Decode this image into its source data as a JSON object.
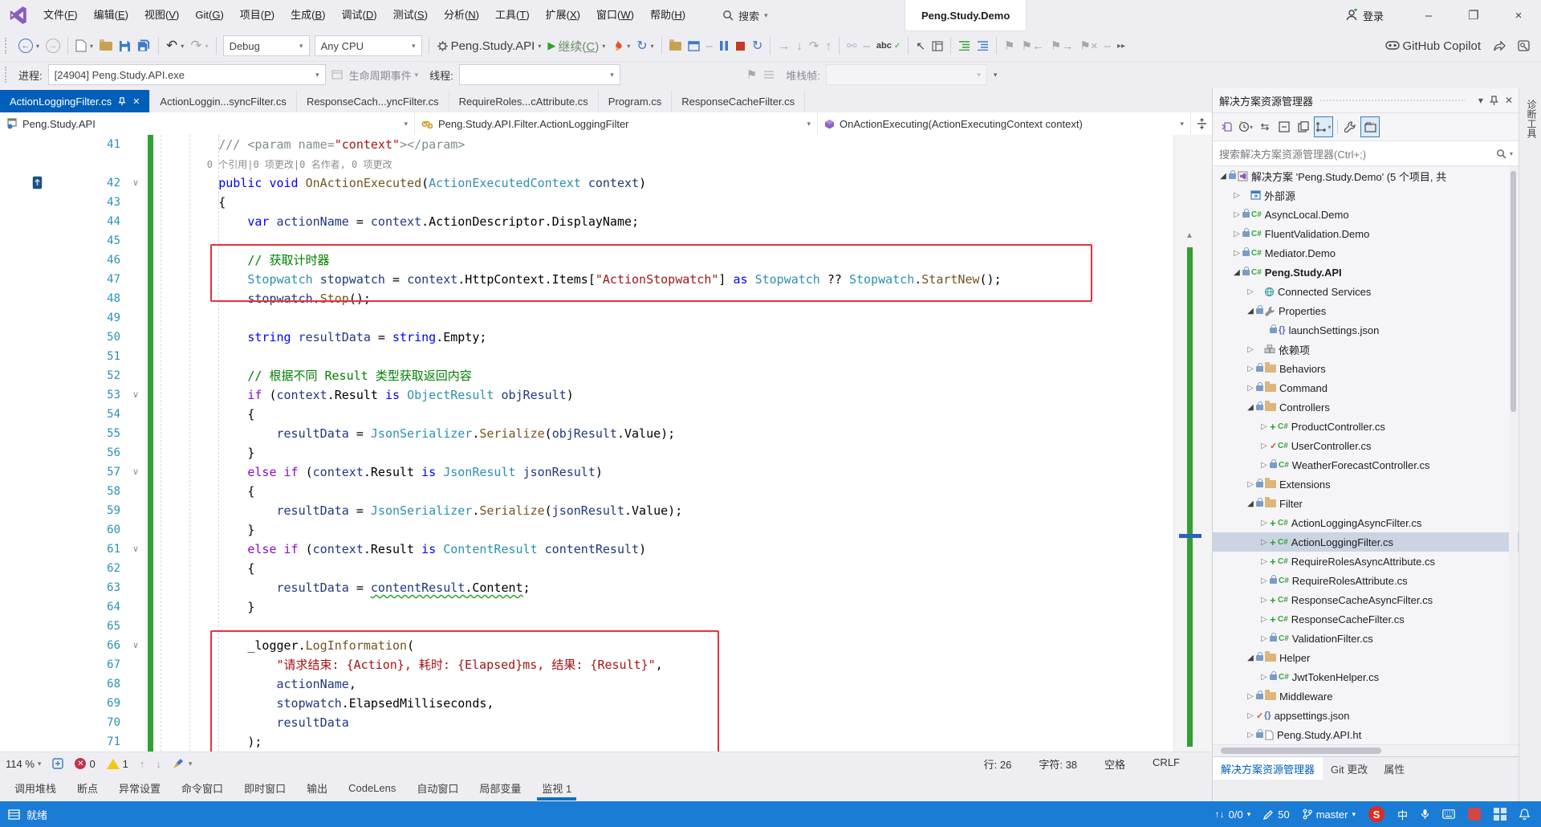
{
  "chrome": {
    "menus": [
      "文件(F)",
      "编辑(E)",
      "视图(V)",
      "Git(G)",
      "项目(P)",
      "生成(B)",
      "调试(D)",
      "测试(S)",
      "分析(N)",
      "工具(T)",
      "扩展(X)",
      "窗口(W)",
      "帮助(H)"
    ],
    "search_label": "搜索",
    "window_title": "Peng.Study.Demo",
    "signin_label": "登录"
  },
  "toolbar": {
    "debug_config": "Debug",
    "platform": "Any CPU",
    "startup_project": "Peng.Study.API",
    "continue_label": "继续(C)",
    "copilot_label": "GitHub Copilot"
  },
  "debugbar": {
    "process_label": "进程:",
    "process_value": "[24904] Peng.Study.API.exe",
    "lifecycle_label": "生命周期事件",
    "thread_label": "线程:",
    "stackframe_label": "堆栈帧:"
  },
  "tabs": [
    {
      "label": "ActionLoggingFilter.cs",
      "active": true
    },
    {
      "label": "ActionLoggin...syncFilter.cs",
      "active": false
    },
    {
      "label": "ResponseCach...yncFilter.cs",
      "active": false
    },
    {
      "label": "RequireRoles...cAttribute.cs",
      "active": false
    },
    {
      "label": "Program.cs",
      "active": false
    },
    {
      "label": "ResponseCacheFilter.cs",
      "active": false
    }
  ],
  "breadcrumb": [
    "Peng.Study.API",
    "Peng.Study.API.Filter.ActionLoggingFilter",
    "OnActionExecuting(ActionExecutingContext context)"
  ],
  "editor": {
    "rows": [
      {
        "n": "41",
        "seg": [
          [
            "dc",
            "        /// <param name="
          ],
          [
            "s",
            "\"context\""
          ],
          [
            "dc",
            "></param>"
          ]
        ]
      },
      {
        "n": "",
        "lens": true,
        "seg": [
          [
            "lens",
            "        0 个引用|0 项更改|0 名作者, 0 项更改"
          ]
        ]
      },
      {
        "n": "42",
        "fold": true,
        "icon": true,
        "seg": [
          [
            "p",
            "        "
          ],
          [
            "k",
            "public"
          ],
          [
            "p",
            " "
          ],
          [
            "k",
            "void"
          ],
          [
            "p",
            " "
          ],
          [
            "m",
            "OnActionExecuted"
          ],
          [
            "p",
            "("
          ],
          [
            "ty",
            "ActionExecutedContext"
          ],
          [
            "p",
            " "
          ],
          [
            "v",
            "context"
          ],
          [
            "p",
            ")"
          ]
        ]
      },
      {
        "n": "43",
        "seg": [
          [
            "p",
            "        {"
          ]
        ]
      },
      {
        "n": "44",
        "seg": [
          [
            "p",
            "            "
          ],
          [
            "k",
            "var"
          ],
          [
            "p",
            " "
          ],
          [
            "v",
            "actionName"
          ],
          [
            "p",
            " = "
          ],
          [
            "v",
            "context"
          ],
          [
            "p",
            ".ActionDescriptor.DisplayName;"
          ]
        ]
      },
      {
        "n": "45",
        "seg": []
      },
      {
        "n": "46",
        "seg": [
          [
            "c",
            "            // 获取计时器"
          ]
        ]
      },
      {
        "n": "47",
        "seg": [
          [
            "p",
            "            "
          ],
          [
            "ty",
            "Stopwatch"
          ],
          [
            "p",
            " "
          ],
          [
            "v",
            "stopwatch"
          ],
          [
            "p",
            " = "
          ],
          [
            "v",
            "context"
          ],
          [
            "p",
            ".HttpContext.Items["
          ],
          [
            "s",
            "\"ActionStopwatch\""
          ],
          [
            "p",
            "] "
          ],
          [
            "k",
            "as"
          ],
          [
            "p",
            " "
          ],
          [
            "ty",
            "Stopwatch"
          ],
          [
            "p",
            " ?? "
          ],
          [
            "ty",
            "Stopwatch"
          ],
          [
            "p",
            "."
          ],
          [
            "m",
            "StartNew"
          ],
          [
            "p",
            "();"
          ]
        ]
      },
      {
        "n": "48",
        "seg": [
          [
            "p",
            "            "
          ],
          [
            "v",
            "stopwatch"
          ],
          [
            "p",
            "."
          ],
          [
            "m",
            "Stop"
          ],
          [
            "p",
            "();"
          ]
        ]
      },
      {
        "n": "49",
        "seg": []
      },
      {
        "n": "50",
        "seg": [
          [
            "p",
            "            "
          ],
          [
            "k",
            "string"
          ],
          [
            "p",
            " "
          ],
          [
            "v",
            "resultData"
          ],
          [
            "p",
            " = "
          ],
          [
            "k",
            "string"
          ],
          [
            "p",
            ".Empty;"
          ]
        ]
      },
      {
        "n": "51",
        "seg": []
      },
      {
        "n": "52",
        "seg": [
          [
            "c",
            "            // 根据不同 Result 类型获取返回内容"
          ]
        ]
      },
      {
        "n": "53",
        "fold": true,
        "seg": [
          [
            "p",
            "            "
          ],
          [
            "ct",
            "if"
          ],
          [
            "p",
            " ("
          ],
          [
            "v",
            "context"
          ],
          [
            "p",
            ".Result "
          ],
          [
            "k",
            "is"
          ],
          [
            "p",
            " "
          ],
          [
            "ty",
            "ObjectResult"
          ],
          [
            "p",
            " "
          ],
          [
            "v",
            "objResult"
          ],
          [
            "p",
            ")"
          ]
        ]
      },
      {
        "n": "54",
        "seg": [
          [
            "p",
            "            {"
          ]
        ]
      },
      {
        "n": "55",
        "seg": [
          [
            "p",
            "                "
          ],
          [
            "v",
            "resultData"
          ],
          [
            "p",
            " = "
          ],
          [
            "ty",
            "JsonSerializer"
          ],
          [
            "p",
            "."
          ],
          [
            "m",
            "Serialize"
          ],
          [
            "p",
            "("
          ],
          [
            "v",
            "objResult"
          ],
          [
            "p",
            ".Value);"
          ]
        ]
      },
      {
        "n": "56",
        "seg": [
          [
            "p",
            "            }"
          ]
        ]
      },
      {
        "n": "57",
        "fold": true,
        "seg": [
          [
            "p",
            "            "
          ],
          [
            "ct",
            "else"
          ],
          [
            "p",
            " "
          ],
          [
            "ct",
            "if"
          ],
          [
            "p",
            " ("
          ],
          [
            "v",
            "context"
          ],
          [
            "p",
            ".Result "
          ],
          [
            "k",
            "is"
          ],
          [
            "p",
            " "
          ],
          [
            "ty",
            "JsonResult"
          ],
          [
            "p",
            " "
          ],
          [
            "v",
            "jsonResult"
          ],
          [
            "p",
            ")"
          ]
        ]
      },
      {
        "n": "58",
        "seg": [
          [
            "p",
            "            {"
          ]
        ]
      },
      {
        "n": "59",
        "seg": [
          [
            "p",
            "                "
          ],
          [
            "v",
            "resultData"
          ],
          [
            "p",
            " = "
          ],
          [
            "ty",
            "JsonSerializer"
          ],
          [
            "p",
            "."
          ],
          [
            "m",
            "Serialize"
          ],
          [
            "p",
            "("
          ],
          [
            "v",
            "jsonResult"
          ],
          [
            "p",
            ".Value);"
          ]
        ]
      },
      {
        "n": "60",
        "seg": [
          [
            "p",
            "            }"
          ]
        ]
      },
      {
        "n": "61",
        "fold": true,
        "seg": [
          [
            "p",
            "            "
          ],
          [
            "ct",
            "else"
          ],
          [
            "p",
            " "
          ],
          [
            "ct",
            "if"
          ],
          [
            "p",
            " ("
          ],
          [
            "v",
            "context"
          ],
          [
            "p",
            ".Result "
          ],
          [
            "k",
            "is"
          ],
          [
            "p",
            " "
          ],
          [
            "ty",
            "ContentResult"
          ],
          [
            "p",
            " "
          ],
          [
            "v",
            "contentResult"
          ],
          [
            "p",
            ")"
          ]
        ]
      },
      {
        "n": "62",
        "seg": [
          [
            "p",
            "            {"
          ]
        ]
      },
      {
        "n": "63",
        "seg": [
          [
            "p",
            "                "
          ],
          [
            "v",
            "resultData"
          ],
          [
            "p",
            " = "
          ],
          [
            "v sq",
            "contentResult"
          ],
          [
            "p sq",
            ".Content"
          ],
          [
            "p",
            ";"
          ]
        ]
      },
      {
        "n": "64",
        "seg": [
          [
            "p",
            "            }"
          ]
        ]
      },
      {
        "n": "65",
        "seg": []
      },
      {
        "n": "66",
        "fold": true,
        "seg": [
          [
            "p",
            "            _logger."
          ],
          [
            "m",
            "LogInformation"
          ],
          [
            "p",
            "("
          ]
        ]
      },
      {
        "n": "67",
        "seg": [
          [
            "p",
            "                "
          ],
          [
            "s",
            "\"请求结束: {Action}, 耗时: {Elapsed}ms, 结果: {Result}\""
          ],
          [
            "p",
            ","
          ]
        ]
      },
      {
        "n": "68",
        "seg": [
          [
            "p",
            "                "
          ],
          [
            "v",
            "actionName"
          ],
          [
            "p",
            ","
          ]
        ]
      },
      {
        "n": "69",
        "seg": [
          [
            "p",
            "                "
          ],
          [
            "v",
            "stopwatch"
          ],
          [
            "p",
            ".ElapsedMilliseconds,"
          ]
        ]
      },
      {
        "n": "70",
        "seg": [
          [
            "p",
            "                "
          ],
          [
            "v",
            "resultData"
          ]
        ]
      },
      {
        "n": "71",
        "seg": [
          [
            "p",
            "            );"
          ]
        ]
      }
    ]
  },
  "solution_explorer": {
    "title": "解决方案资源管理器",
    "search_placeholder": "搜索解决方案资源管理器(Ctrl+;)",
    "items": [
      {
        "t": "解决方案 'Peng.Study.Demo' (5 个项目, 共",
        "d": 0,
        "a": "d",
        "lock": true,
        "ic": "sln"
      },
      {
        "t": "外部源",
        "d": 1,
        "a": "r",
        "ic": "ext"
      },
      {
        "t": "AsyncLocal.Demo",
        "d": 1,
        "a": "r",
        "lock": true,
        "ic": "csproj"
      },
      {
        "t": "FluentValidation.Demo",
        "d": 1,
        "a": "r",
        "lock": true,
        "ic": "csproj"
      },
      {
        "t": "Mediator.Demo",
        "d": 1,
        "a": "r",
        "lock": true,
        "ic": "csproj"
      },
      {
        "t": "Peng.Study.API",
        "d": 1,
        "a": "d",
        "lock": true,
        "ic": "csproj",
        "bold": true
      },
      {
        "t": "Connected Services",
        "d": 2,
        "a": "r",
        "ic": "svc"
      },
      {
        "t": "Properties",
        "d": 2,
        "a": "d",
        "lock": true,
        "ic": "prop"
      },
      {
        "t": "launchSettings.json",
        "d": 3,
        "lock": true,
        "ic": "json"
      },
      {
        "t": "依赖项",
        "d": 2,
        "a": "r",
        "ic": "dep"
      },
      {
        "t": "Behaviors",
        "d": 2,
        "a": "r",
        "lock": true,
        "ic": "folder"
      },
      {
        "t": "Command",
        "d": 2,
        "a": "r",
        "lock": true,
        "ic": "folder"
      },
      {
        "t": "Controllers",
        "d": 2,
        "a": "d",
        "lock": true,
        "ic": "folder"
      },
      {
        "t": "ProductController.cs",
        "d": 3,
        "a": "r",
        "b": "plus",
        "ic": "cs"
      },
      {
        "t": "UserController.cs",
        "d": 3,
        "a": "r",
        "b": "check",
        "ic": "cs"
      },
      {
        "t": "WeatherForecastController.cs",
        "d": 3,
        "a": "r",
        "lock": true,
        "ic": "cs"
      },
      {
        "t": "Extensions",
        "d": 2,
        "a": "r",
        "lock": true,
        "ic": "folder"
      },
      {
        "t": "Filter",
        "d": 2,
        "a": "d",
        "lock": true,
        "ic": "folder"
      },
      {
        "t": "ActionLoggingAsyncFilter.cs",
        "d": 3,
        "a": "r",
        "b": "plus",
        "ic": "cs"
      },
      {
        "t": "ActionLoggingFilter.cs",
        "d": 3,
        "a": "r",
        "b": "plus",
        "ic": "cs",
        "sel": true
      },
      {
        "t": "RequireRolesAsyncAttribute.cs",
        "d": 3,
        "a": "r",
        "b": "plus",
        "ic": "cs"
      },
      {
        "t": "RequireRolesAttribute.cs",
        "d": 3,
        "a": "r",
        "lock": true,
        "ic": "cs"
      },
      {
        "t": "ResponseCacheAsyncFilter.cs",
        "d": 3,
        "a": "r",
        "b": "plus",
        "ic": "cs"
      },
      {
        "t": "ResponseCacheFilter.cs",
        "d": 3,
        "a": "r",
        "b": "plus",
        "ic": "cs"
      },
      {
        "t": "ValidationFilter.cs",
        "d": 3,
        "a": "r",
        "lock": true,
        "ic": "cs"
      },
      {
        "t": "Helper",
        "d": 2,
        "a": "d",
        "lock": true,
        "ic": "folder"
      },
      {
        "t": "JwtTokenHelper.cs",
        "d": 3,
        "a": "r",
        "lock": true,
        "ic": "cs"
      },
      {
        "t": "Middleware",
        "d": 2,
        "a": "r",
        "lock": true,
        "ic": "folder"
      },
      {
        "t": "appsettings.json",
        "d": 2,
        "a": "r",
        "b": "check",
        "ic": "json"
      },
      {
        "t": "Peng.Study.API.ht",
        "d": 2,
        "a": "r",
        "lock": true,
        "ic": "doc"
      }
    ],
    "panel_tabs": [
      {
        "label": "解决方案资源管理器",
        "active": true
      },
      {
        "label": "Git 更改",
        "active": false
      },
      {
        "label": "属性",
        "active": false
      }
    ]
  },
  "side_tab": "诊断工具",
  "editor_status": {
    "zoom": "114 %",
    "errors": "0",
    "warnings": "1",
    "line": "行: 26",
    "column": "字符: 38",
    "space": "空格",
    "eol": "CRLF"
  },
  "bottom_tabs": [
    "调用堆栈",
    "断点",
    "异常设置",
    "命令窗口",
    "即时窗口",
    "输出",
    "CodeLens",
    "自动窗口",
    "局部变量",
    "监视 1"
  ],
  "statusbar": {
    "ready": "就绪",
    "sync": "0/0",
    "edits": "50",
    "branch": "master",
    "app_badge": "S",
    "ime": "中"
  }
}
